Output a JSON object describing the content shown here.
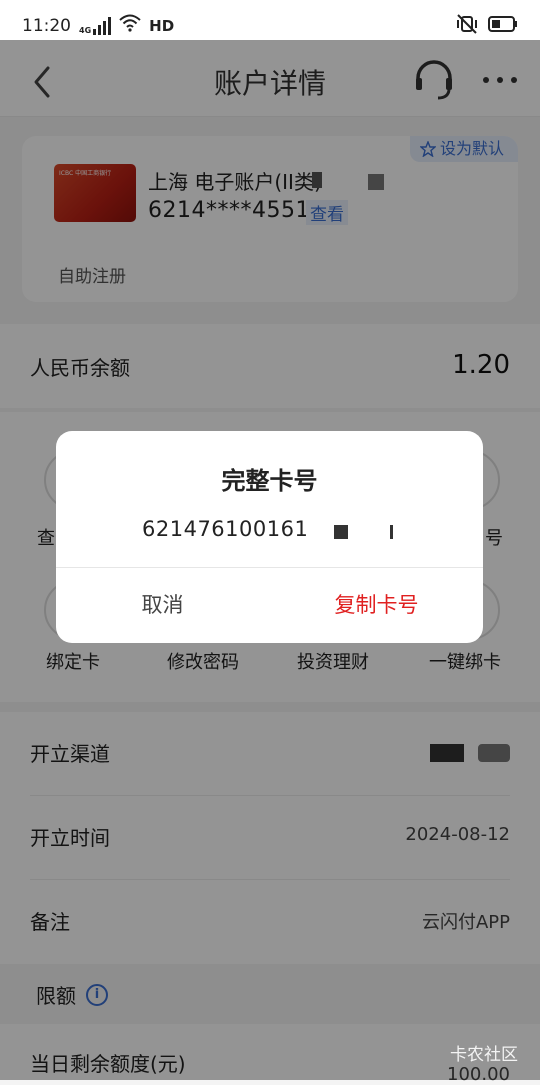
{
  "status_bar": {
    "time": "11:20",
    "network": "4G",
    "hd": "HD"
  },
  "header": {
    "title": "账户详情"
  },
  "account_card": {
    "name": "上海 电子账户(II类)",
    "number_masked": "6214****4551",
    "view_label": "查看",
    "default_label": "设为默认",
    "register_label": "自助注册",
    "card_brand_text": "ICBC 中国工商银行"
  },
  "balance": {
    "label": "人民币余额",
    "value": "1.20"
  },
  "actions": {
    "row1": [
      "查",
      "",
      "",
      "号"
    ],
    "row2": [
      "绑定卡",
      "修改密码",
      "投资理财",
      "一键绑卡"
    ]
  },
  "info": {
    "channel_label": "开立渠道",
    "time_label": "开立时间",
    "time_value": "2024-08-12",
    "note_label": "备注",
    "note_value": "云闪付APP"
  },
  "limits": {
    "header": "限额",
    "daily_label": "当日剩余额度(元)",
    "daily_value": "100.00"
  },
  "dialog": {
    "title": "完整卡号",
    "number": "621476100161",
    "cancel_label": "取消",
    "copy_label": "复制卡号"
  },
  "watermark": "卡农社区",
  "colors": {
    "accent_blue": "#3b6fd1",
    "copy_red": "#e02020"
  }
}
